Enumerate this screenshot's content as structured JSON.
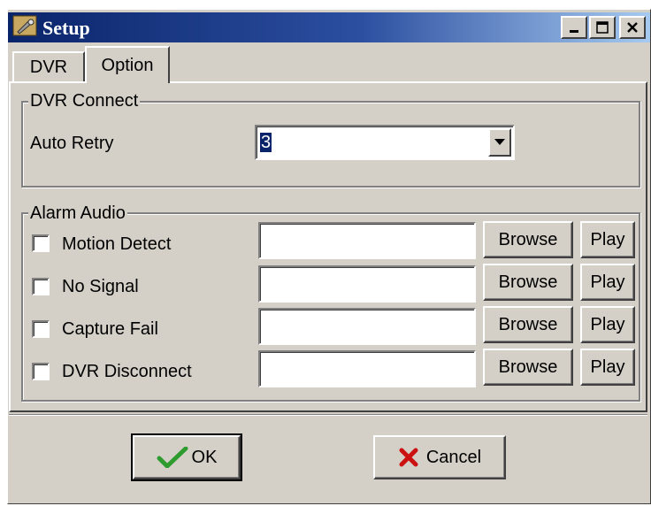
{
  "window": {
    "title": "Setup",
    "icon": "setup-wrench-icon"
  },
  "tabs": [
    {
      "label": "DVR",
      "selected": false
    },
    {
      "label": "Option",
      "selected": true
    }
  ],
  "dvr_connect": {
    "legend": "DVR Connect",
    "auto_retry_label": "Auto Retry",
    "auto_retry_value": "3"
  },
  "alarm_audio": {
    "legend": "Alarm Audio",
    "rows": [
      {
        "label": "Motion Detect",
        "checked": false,
        "path": "",
        "browse": "Browse",
        "play": "Play"
      },
      {
        "label": "No Signal",
        "checked": false,
        "path": "",
        "browse": "Browse",
        "play": "Play"
      },
      {
        "label": "Capture Fail",
        "checked": false,
        "path": "",
        "browse": "Browse",
        "play": "Play"
      },
      {
        "label": "DVR Disconnect",
        "checked": false,
        "path": "",
        "browse": "Browse",
        "play": "Play"
      }
    ]
  },
  "buttons": {
    "ok": "OK",
    "cancel": "Cancel"
  },
  "colors": {
    "face": "#d4d0c8",
    "title_start": "#0a246a",
    "title_end": "#a6caf0",
    "ok_check": "#2e9b2e",
    "cancel_x": "#cc1111"
  }
}
